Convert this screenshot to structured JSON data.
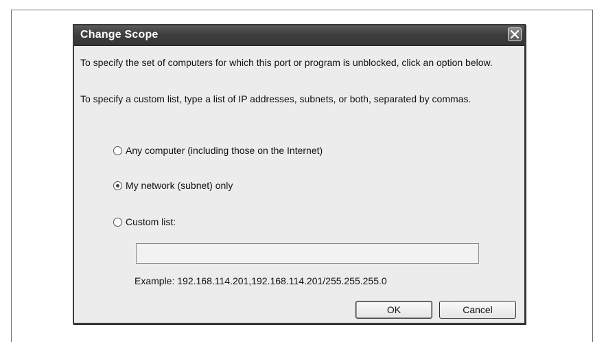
{
  "dialog": {
    "title": "Change Scope",
    "intro_text": "To specify the set of computers for which this port or program is unblocked, click an option below.",
    "custom_help_text": "To specify a custom list, type a list of IP addresses, subnets, or both, separated by commas.",
    "options": [
      {
        "label": "Any computer (including those on the Internet)",
        "selected": false
      },
      {
        "label": "My network (subnet) only",
        "selected": true
      },
      {
        "label": "Custom list:",
        "selected": false
      }
    ],
    "custom_list_value": "",
    "example_text": "Example: 192.168.114.201,192.168.114.201/255.255.255.0",
    "ok_label": "OK",
    "cancel_label": "Cancel"
  },
  "icons": {
    "close": "close-icon"
  }
}
